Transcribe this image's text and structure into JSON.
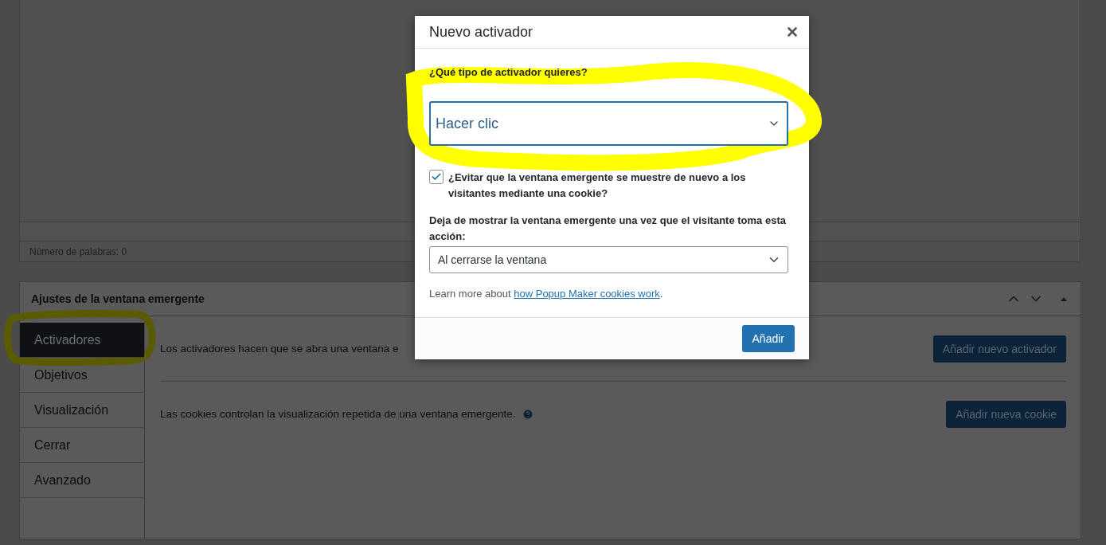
{
  "editor": {
    "word_count": "Número de palabras: 0"
  },
  "metabox": {
    "title": "Ajustes de la ventana emergente",
    "tabs": [
      {
        "label": "Activadores",
        "selected": true
      },
      {
        "label": "Objetivos",
        "selected": false
      },
      {
        "label": "Visualización",
        "selected": false
      },
      {
        "label": "Cerrar",
        "selected": false
      },
      {
        "label": "Avanzado",
        "selected": false
      }
    ],
    "rows": [
      {
        "text": "Los activadores hacen que se abra una ventana e",
        "help": false,
        "button": "Añadir nuevo activador"
      },
      {
        "text": "Las cookies controlan la visualización repetida de una ventana emergente.",
        "help": true,
        "button": "Añadir nueva cookie"
      }
    ]
  },
  "modal": {
    "title": "Nuevo activador",
    "trigger_question": "¿Qué tipo de activador quieres?",
    "trigger_select": {
      "value": "Hacer clic"
    },
    "cookie_checkbox": {
      "label": "¿Evitar que la ventana emergente se muestre de nuevo a los visitantes mediante una cookie?",
      "checked": true
    },
    "cookie_action_label": "Deja de mostrar la ventana emergente una vez que el visitante toma esta acción:",
    "cookie_action_select": {
      "value": "Al cerrarse la ventana"
    },
    "learn_more": {
      "text": "Learn more about",
      "link": "how Popup Maker cookies work",
      "suffix": "."
    },
    "submit": "Añadir"
  }
}
